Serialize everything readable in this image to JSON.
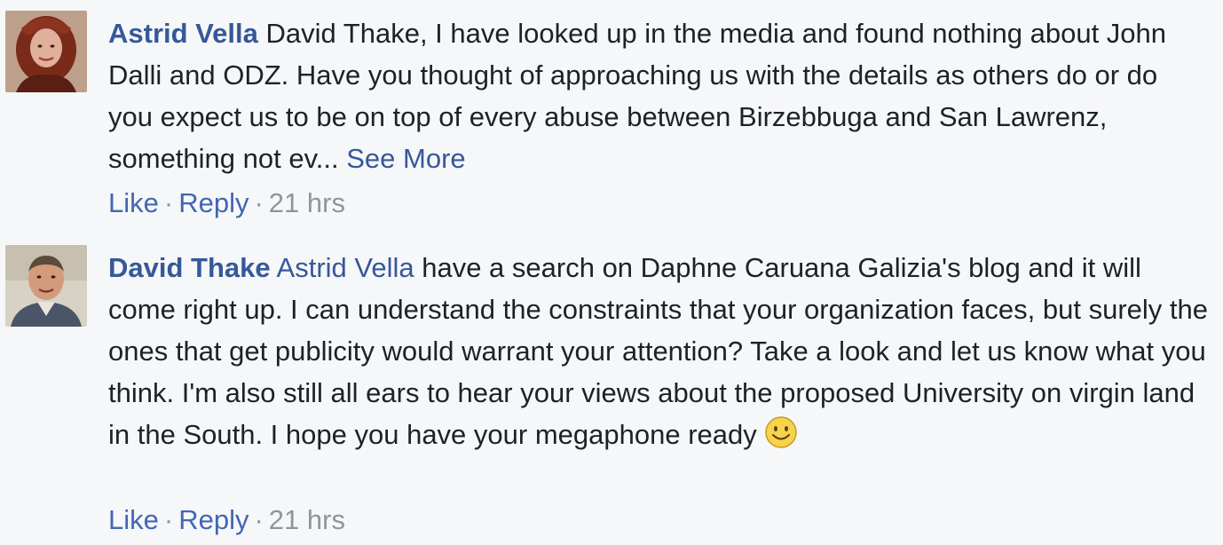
{
  "comments": [
    {
      "author": "Astrid Vella",
      "avatar_icon": "astrid-vella-avatar",
      "text": " David Thake, I have looked up in the media and found nothing about John Dalli and ODZ. Have you thought of approaching us with the details as others do or do you expect us to be on top of every abuse between Birzebbuga and San Lawrenz, something not ev... ",
      "see_more": "See More",
      "like": "Like",
      "reply": "Reply",
      "sep": "·",
      "time": "21 hrs"
    },
    {
      "author": "David Thake",
      "avatar_icon": "david-thake-avatar",
      "mention": "Astrid Vella",
      "text": " have a search on Daphne Caruana Galizia's blog and it will come right up. I can understand the constraints that your organization faces, but surely the ones that get publicity would warrant your attention? Take a look and let us know what you think. I'm also still all ears to hear your views about the proposed University on virgin land in the South. I hope you have your megaphone ready",
      "emoji_icon": "smiley-emoji-icon",
      "like": "Like",
      "reply": "Reply",
      "sep": "·",
      "time": "21 hrs"
    }
  ],
  "colors": {
    "link": "#365899",
    "action_link": "#4267b2",
    "meta": "#90949c",
    "text": "#1d2129",
    "background": "#f6f7f9"
  }
}
